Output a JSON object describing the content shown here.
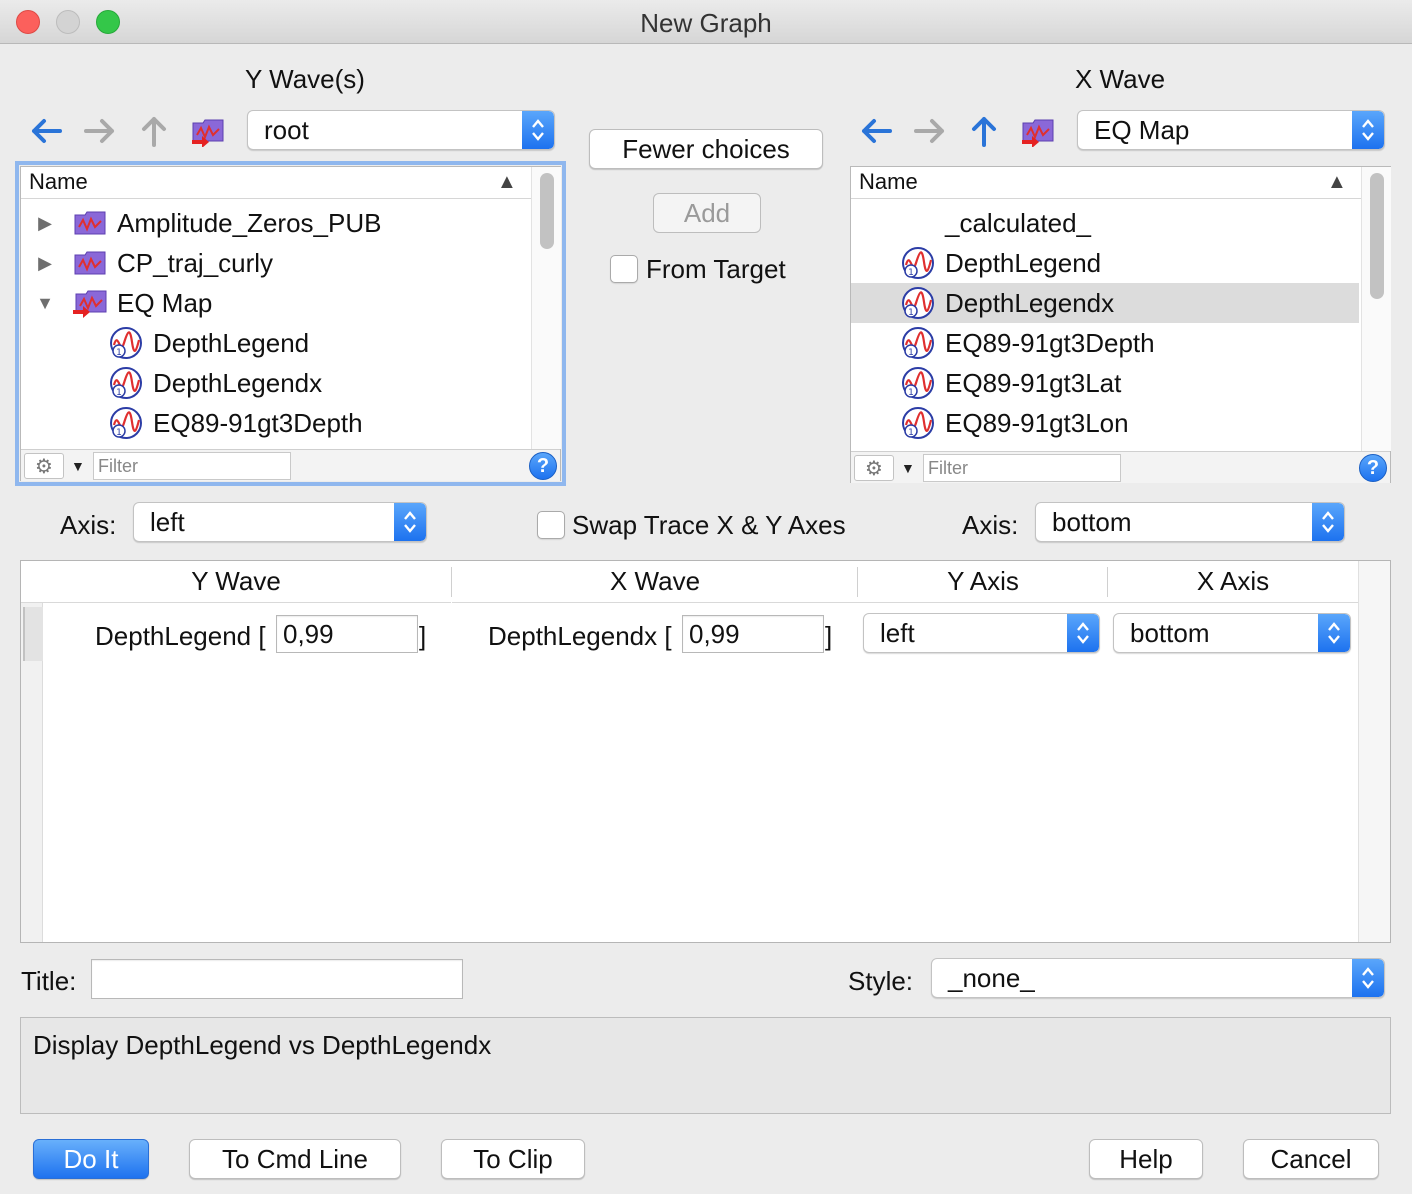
{
  "window": {
    "title": "New Graph"
  },
  "left_panel": {
    "heading": "Y Wave(s)",
    "folder_popup": "root",
    "column": "Name",
    "items": [
      {
        "label": "Amplitude_Zeros_PUB",
        "kind": "folder",
        "expand": "collapsed"
      },
      {
        "label": "CP_traj_curly",
        "kind": "folder",
        "expand": "collapsed"
      },
      {
        "label": "EQ Map",
        "kind": "folder-current",
        "expand": "expanded"
      },
      {
        "label": "DepthLegend",
        "kind": "wave"
      },
      {
        "label": "DepthLegendx",
        "kind": "wave"
      },
      {
        "label": "EQ89-91gt3Depth",
        "kind": "wave"
      }
    ],
    "filter_placeholder": "Filter"
  },
  "right_panel": {
    "heading": "X Wave",
    "folder_popup": "EQ Map",
    "column": "Name",
    "items": [
      {
        "label": "_calculated_",
        "kind": "none"
      },
      {
        "label": "DepthLegend",
        "kind": "wave"
      },
      {
        "label": "DepthLegendx",
        "kind": "wave",
        "selected": true
      },
      {
        "label": "EQ89-91gt3Depth",
        "kind": "wave"
      },
      {
        "label": "EQ89-91gt3Lat",
        "kind": "wave"
      },
      {
        "label": "EQ89-91gt3Lon",
        "kind": "wave"
      }
    ],
    "filter_placeholder": "Filter"
  },
  "middle": {
    "fewer_choices": "Fewer choices",
    "add": "Add",
    "from_target": "From Target"
  },
  "axis_row": {
    "y_axis_label": "Axis:",
    "y_axis_value": "left",
    "swap_label": "Swap Trace X & Y Axes",
    "x_axis_label": "Axis:",
    "x_axis_value": "bottom"
  },
  "table": {
    "headers": [
      "Y Wave",
      "X Wave",
      "Y Axis",
      "X Axis"
    ],
    "row": {
      "y_wave": "DepthLegend [",
      "y_range": "0,99",
      "x_wave": "DepthLegendx [",
      "x_range": "0,99",
      "close": "]",
      "y_axis": "left",
      "x_axis": "bottom"
    }
  },
  "title_row": {
    "title_label": "Title:",
    "title_value": "",
    "style_label": "Style:",
    "style_value": "_none_"
  },
  "command": "Display DepthLegend vs DepthLegendx",
  "buttons": {
    "do_it": "Do It",
    "to_cmd_line": "To Cmd Line",
    "to_clip": "To Clip",
    "help": "Help",
    "cancel": "Cancel"
  },
  "icons": {
    "back": "arrow-left-icon",
    "forward": "arrow-right-icon",
    "up": "arrow-up-icon",
    "set_current": "set-current-folder-icon",
    "folder": "folder-icon",
    "wave": "wave-icon",
    "gear": "gear-icon",
    "help": "help-icon"
  }
}
